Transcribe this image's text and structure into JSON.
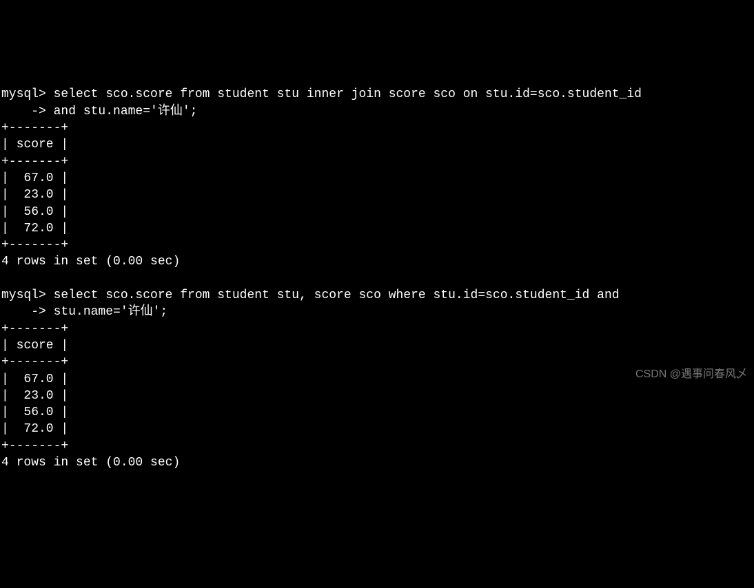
{
  "terminal": {
    "prompt": "mysql>",
    "continuation": "    ->",
    "query1": {
      "line1": " select sco.score from student stu inner join score sco on stu.id=sco.student_id",
      "line2": " and stu.name='许仙';"
    },
    "query2": {
      "line1": " select sco.score from student stu, score sco where stu.id=sco.student_id and",
      "line2": " stu.name='许仙';"
    },
    "table": {
      "border": "+-------+",
      "header": "| score |",
      "rows": [
        "|  67.0 |",
        "|  23.0 |",
        "|  56.0 |",
        "|  72.0 |"
      ]
    },
    "result_status": "4 rows in set (0.00 sec)",
    "blank": ""
  },
  "watermark": "CSDN @遇事问春风乄"
}
